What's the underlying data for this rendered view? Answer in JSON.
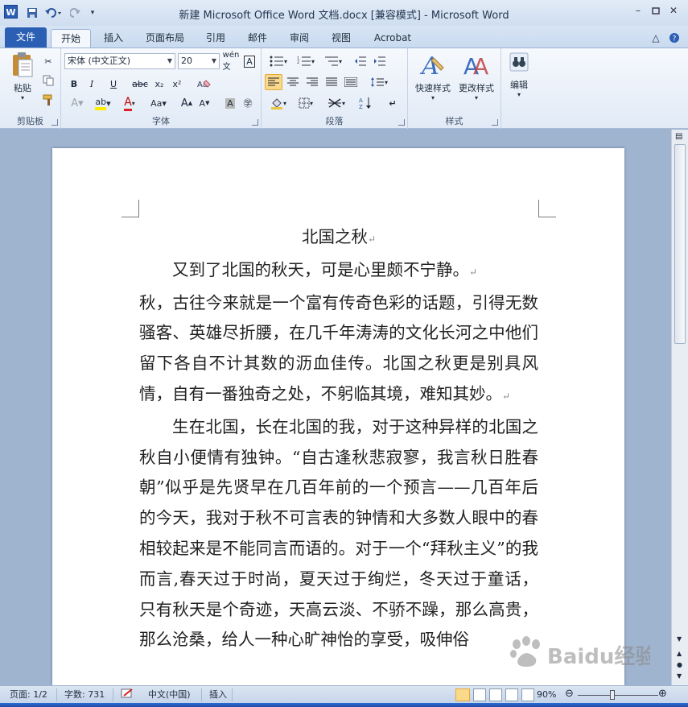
{
  "window": {
    "title": "新建 Microsoft Office Word 文档.docx [兼容模式]  -  Microsoft Word",
    "app_icon": "W"
  },
  "quick_access": {
    "save": "save-icon",
    "undo": "undo-icon",
    "redo": "redo-icon",
    "customize": "customize-icon"
  },
  "tabs": [
    {
      "label": "文件"
    },
    {
      "label": "开始"
    },
    {
      "label": "插入"
    },
    {
      "label": "页面布局"
    },
    {
      "label": "引用"
    },
    {
      "label": "邮件"
    },
    {
      "label": "审阅"
    },
    {
      "label": "视图"
    },
    {
      "label": "Acrobat"
    }
  ],
  "ribbon": {
    "clipboard": {
      "label": "剪贴板",
      "paste": "粘贴"
    },
    "font": {
      "label": "字体",
      "font_name": "宋体 (中文正文)",
      "font_size": "20",
      "bold": "B",
      "italic": "I",
      "underline": "U",
      "strike": "abc",
      "sub": "x₂",
      "sup": "x²",
      "grow": "A",
      "shrink": "A",
      "case": "Aa"
    },
    "paragraph": {
      "label": "段落"
    },
    "styles": {
      "label": "样式",
      "quick": "快速样式",
      "change": "更改样式"
    },
    "editing": {
      "label": "编辑"
    }
  },
  "document": {
    "title": "北国之秋",
    "paragraphs": [
      "又到了北国的秋天，可是心里颇不宁静。",
      "秋，古往今来就是一个富有传奇色彩的话题，引得无数骚客、英雄尽折腰，在几千年涛涛的文化长河之中他们留下各自不计其数的沥血佳传。北国之秋更是别具风情，自有一番独奇之处，不躬临其境，难知其妙。",
      "生在北国，长在北国的我，对于这种异样的北国之秋自小便情有独钟。“自古逢秋悲寂寥，我言秋日胜春朝”似乎是先贤早在几百年前的一个预言——几百年后的今天，我对于秋不可言表的钟情和大多数人眼中的春相较起来是不能同言而语的。对于一个“拜秋主义”的我而言,春天过于时尚，夏天过于绚烂，冬天过于童话，只有秋天是个奇迹，天高云淡、不骄不躁，那么高贵，那么沧桑，给人一种心旷神怡的享受，吸伸俗"
    ]
  },
  "status": {
    "page": "页面: 1/2",
    "words": "字数: 731",
    "language": "中文(中国)",
    "mode": "插入",
    "zoom": "90%"
  },
  "watermark": {
    "text": "Baidu经验"
  },
  "colors": {
    "file_tab": "#2b5fb4",
    "selected": "#fbd98a",
    "workspace": "#9fb4cf"
  }
}
